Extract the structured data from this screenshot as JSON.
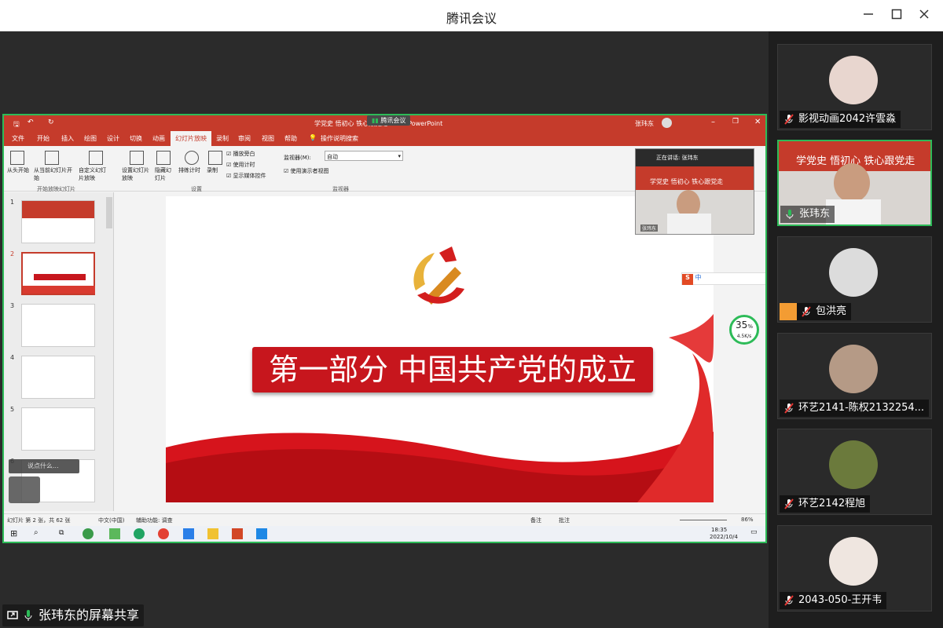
{
  "app": {
    "title": "腾讯会议"
  },
  "share": {
    "label": "张玮东的屏幕共享"
  },
  "ppt": {
    "doc_title": "学党史 悟初心 铁心跟党走 - 30 - PowerPoint",
    "meeting_tag": "腾讯会议",
    "user": "张玮东",
    "tabs": [
      "文件",
      "开始",
      "插入",
      "绘图",
      "设计",
      "切换",
      "动画",
      "幻灯片放映",
      "录制",
      "审阅",
      "视图",
      "帮助",
      "操作说明搜索"
    ],
    "active_tab": "幻灯片放映",
    "ribbon": {
      "from_start": "从头开始",
      "from_current": "从当前幻灯片开始",
      "custom": "自定义幻灯片放映",
      "group1": "开始放映幻灯片",
      "setup": "设置幻灯片放映",
      "hide": "隐藏幻灯片",
      "rehearse": "排练计时",
      "record": "录制",
      "chk_narration": "播放旁白",
      "chk_timing": "使用计时",
      "chk_media": "显示媒体控件",
      "group2": "设置",
      "monitor_label": "监视器(M):",
      "monitor_value": "自动",
      "presenter": "使用演示者视图",
      "group3": "监视器"
    },
    "thumb_numbers": [
      "1",
      "2",
      "3",
      "4",
      "5",
      "6"
    ],
    "slide": {
      "headline": "第一部分  中国共产党的成立"
    },
    "status": {
      "slide_info": "幻灯片 第 2 张，共 62 张",
      "lang": "中文(中国)",
      "access": "辅助功能: 调查",
      "notes": "备注",
      "comments": "批注",
      "zoom": "86%"
    },
    "taskbar": {
      "time": "18:35",
      "date": "2022/10/4"
    },
    "pip": {
      "speaking": "正在讲话: 张玮东",
      "slide_text": "学党史 悟初心 铁心跟党走",
      "name": "张玮东"
    },
    "ime": "中",
    "net": {
      "percent": "35",
      "unit": "%",
      "speed": "4.5K/s"
    },
    "input_hint": "说点什么..."
  },
  "participants": [
    {
      "name": "影视动画2042许雲淼",
      "avatar_color": "#e8d6cf",
      "muted": true
    },
    {
      "name": "张玮东",
      "avatar_color": "#c53b2b",
      "muted": false,
      "active": true,
      "headline": "学党史 悟初心 铁心跟党走"
    },
    {
      "name": "包洪亮",
      "avatar_color": "#dcdcdc",
      "muted": true
    },
    {
      "name": "环艺2141-陈权2132254...",
      "avatar_color": "#b59a86",
      "muted": true
    },
    {
      "name": "环艺2142程旭",
      "avatar_color": "#6b7a3c",
      "muted": true
    },
    {
      "name": "2043-050-王开韦",
      "avatar_color": "#efe6e0",
      "muted": true
    }
  ],
  "colors": {
    "accent": "#2dbb58",
    "ppt_red": "#c53b2b",
    "banner_red": "#c7161d"
  }
}
